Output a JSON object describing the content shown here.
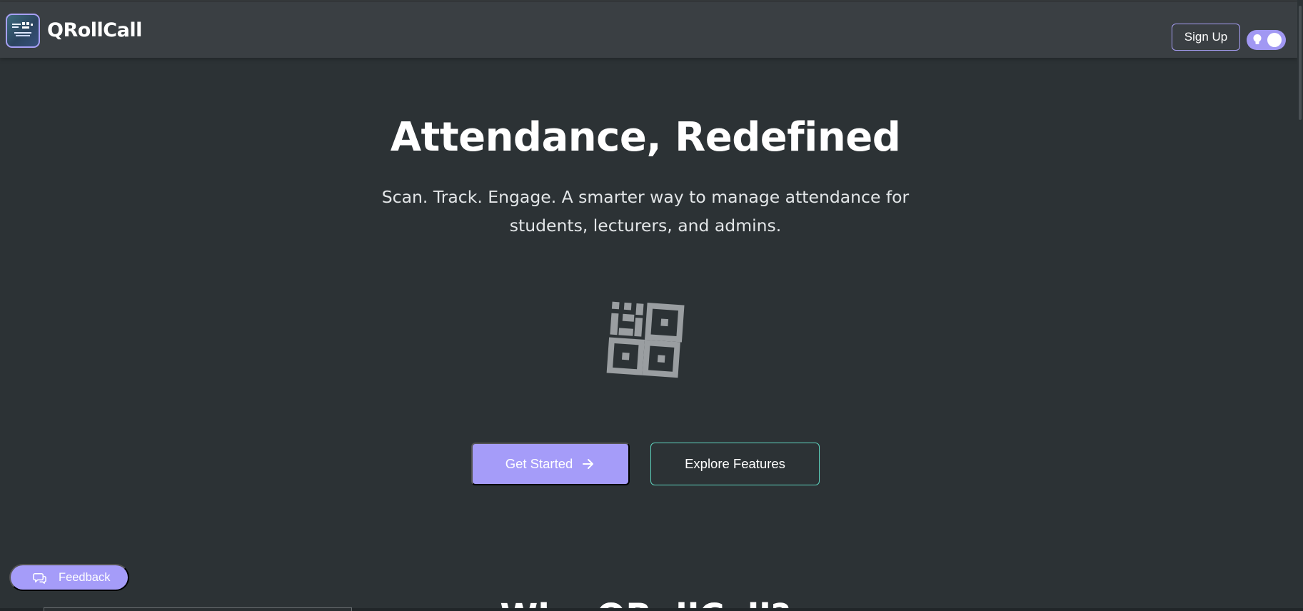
{
  "app": {
    "brand_name": "QRollCall",
    "logo_icon": "qr-logo-icon"
  },
  "header": {
    "signup_label": "Sign Up",
    "theme_toggle_icon": "lightbulb-icon"
  },
  "hero": {
    "title": "Attendance, Redefined",
    "subtitle": "Scan. Track. Engage. A smarter way to manage attendance for students, lecturers, and admins.",
    "illustration_icon": "qr-code-icon",
    "primary_cta": "Get Started",
    "primary_cta_icon": "arrow-right-icon",
    "secondary_cta": "Explore Features"
  },
  "next_section": {
    "heading": "Why QRollCall?"
  },
  "feedback": {
    "label": "Feedback",
    "icon": "chat-bubbles-icon"
  },
  "colors": {
    "background": "#2c3235",
    "navbar": "#3a3f43",
    "accent_purple": "#a59cf9",
    "accent_teal": "#5fd4bf",
    "qr_gray": "#9a9ea1"
  }
}
